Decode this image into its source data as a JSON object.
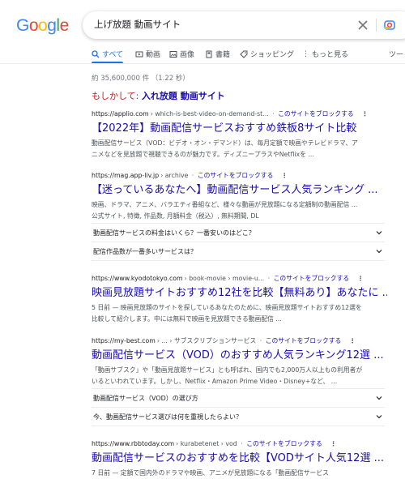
{
  "header": {
    "logo": {
      "letters": [
        "G",
        "o",
        "o",
        "g",
        "l",
        "e"
      ],
      "colors": [
        "#4285F4",
        "#EA4335",
        "#FBBC05",
        "#4285F4",
        "#34A853",
        "#EA4335"
      ]
    },
    "query": "上げ放題 動画サイト"
  },
  "tabs": [
    {
      "label": "すべて",
      "icon": "search-icon",
      "active": true
    },
    {
      "label": "動画",
      "icon": "video-icon"
    },
    {
      "label": "画像",
      "icon": "image-icon"
    },
    {
      "label": "書籍",
      "icon": "book-icon"
    },
    {
      "label": "ショッピング",
      "icon": "tag-icon"
    },
    {
      "label": "もっと見る",
      "icon": "more-icon"
    },
    {
      "label": "ツー",
      "icon": ""
    }
  ],
  "stats": "約 35,600,000 件 （1.22 秒）",
  "spell": {
    "label": "もしかして: ",
    "suggestion": "入れ放題 動画サイト"
  },
  "block_label": "このサイトをブロックする",
  "results": [
    {
      "url": "https://applio.com",
      "path": " › which-is-best-video-on-demand-st...",
      "title": "【2022年】動画配信サービスおすすめ鉄板8サイト比較",
      "snippet": [
        "動画配信サービス（VOD：ビデオ・オン・デマンド）は、毎月定額で映画やテレビドラマ、ア",
        "ニメなどを見放題で視聴できるのが魅力です。ディズニープラスやNetflixを ..."
      ]
    },
    {
      "url": "https://mag.app-liv.jp",
      "path": " › archive",
      "title": "【迷っているあなたへ】動画配信サービス人気ランキング ...",
      "snippet": [
        "映画、ドラマ、アニメ、バラエティ番組など、様々な動画が見放題になる定額制の動画配信 ...",
        "公式サイト, 特徴, 作品数, 月額料金（税込）, 無料期間, DL"
      ],
      "faqs": [
        "動画配信サービスの料金はいくら？一番安いのはどこ？",
        "配信作品数が一番多いサービスは？"
      ]
    },
    {
      "url": "https://www.kyodotokyo.com",
      "path": " › book-movie › movie-u...",
      "title": "映画見放題サイトおすすめ12社を比較【無料あり】あなたに ...",
      "snippet": [
        "5 日前 — 映画見放題のサイトを探しているあなたのために、映画見放題サイトおすすめ12選を",
        "比較して紹介します。中には無料で映画を見放題できる動画配信 ..."
      ]
    },
    {
      "url": "https://my-best.com",
      "path": " › ... › サブスクリプションサービス",
      "title": "動画配信サービス（VOD）のおすすめ人気ランキング12選 ...",
      "snippet": [
        "「動画サブスク」や「動画見放題サービス」とも呼ばれ、国内でも2,000万人以上もの利用者が",
        "いるといわれています。しかし、Netflix・Amazon Prime Video・Disney+など、 ..."
      ],
      "faqs": [
        "動画配信サービス（VOD）の選び方",
        "今、動画配信サービス選びは何を重視したらよい？"
      ]
    },
    {
      "url": "https://www.rbbtoday.com",
      "path": " › kurabetenet › vod",
      "title": "動画配信サービスのおすすめを比較【VODサイト人気12選 ...",
      "snippet": [
        "7 日前 — 定額で国内外のドラマや映画、アニメが見放題になる「動画配信サービス"
      ]
    }
  ]
}
